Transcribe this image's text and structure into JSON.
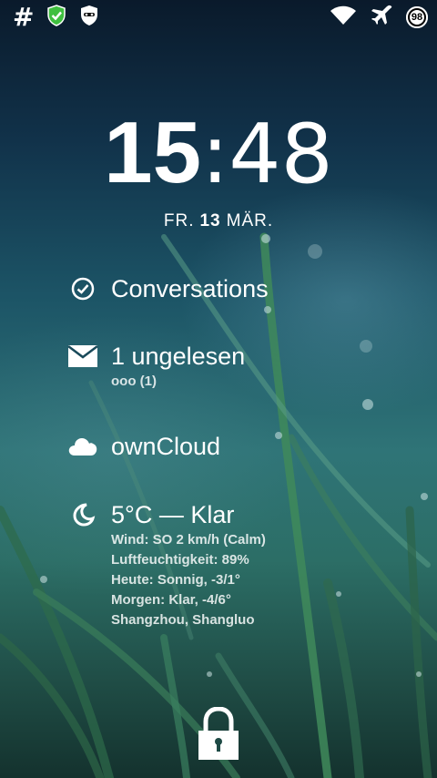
{
  "status_bar": {
    "left_icons": [
      "hash-icon",
      "shield-check-icon",
      "incognito-icon"
    ],
    "hash_glyph": "#",
    "right_icons": [
      "wifi-icon",
      "airplane-icon",
      "battery-icon"
    ],
    "battery_level": "98"
  },
  "clock": {
    "hours": "15",
    "separator": ":",
    "minutes": "48"
  },
  "date": {
    "weekday": "FR.",
    "day": "13",
    "month": "MÄR."
  },
  "notifications": {
    "conversations": {
      "icon": "check-circle-icon",
      "title": "Conversations"
    },
    "email": {
      "icon": "envelope-icon",
      "title": "1 ungelesen",
      "detail": "ooo (1)"
    },
    "owncloud": {
      "icon": "cloud-icon",
      "title": "ownCloud"
    }
  },
  "weather": {
    "icon": "moon-icon",
    "title": "5°C — Klar",
    "wind": "Wind: SO 2 km/h (Calm)",
    "humidity": "Luftfeuchtigkeit: 89%",
    "today": "Heute: Sonnig, -3/1°",
    "tomorrow": "Morgen: Klar, -4/6°",
    "location": "Shangzhou, Shangluo"
  },
  "lock": {
    "icon": "padlock-icon"
  },
  "colors": {
    "text": "#ffffff",
    "shield_green": "#3fbf3f"
  }
}
